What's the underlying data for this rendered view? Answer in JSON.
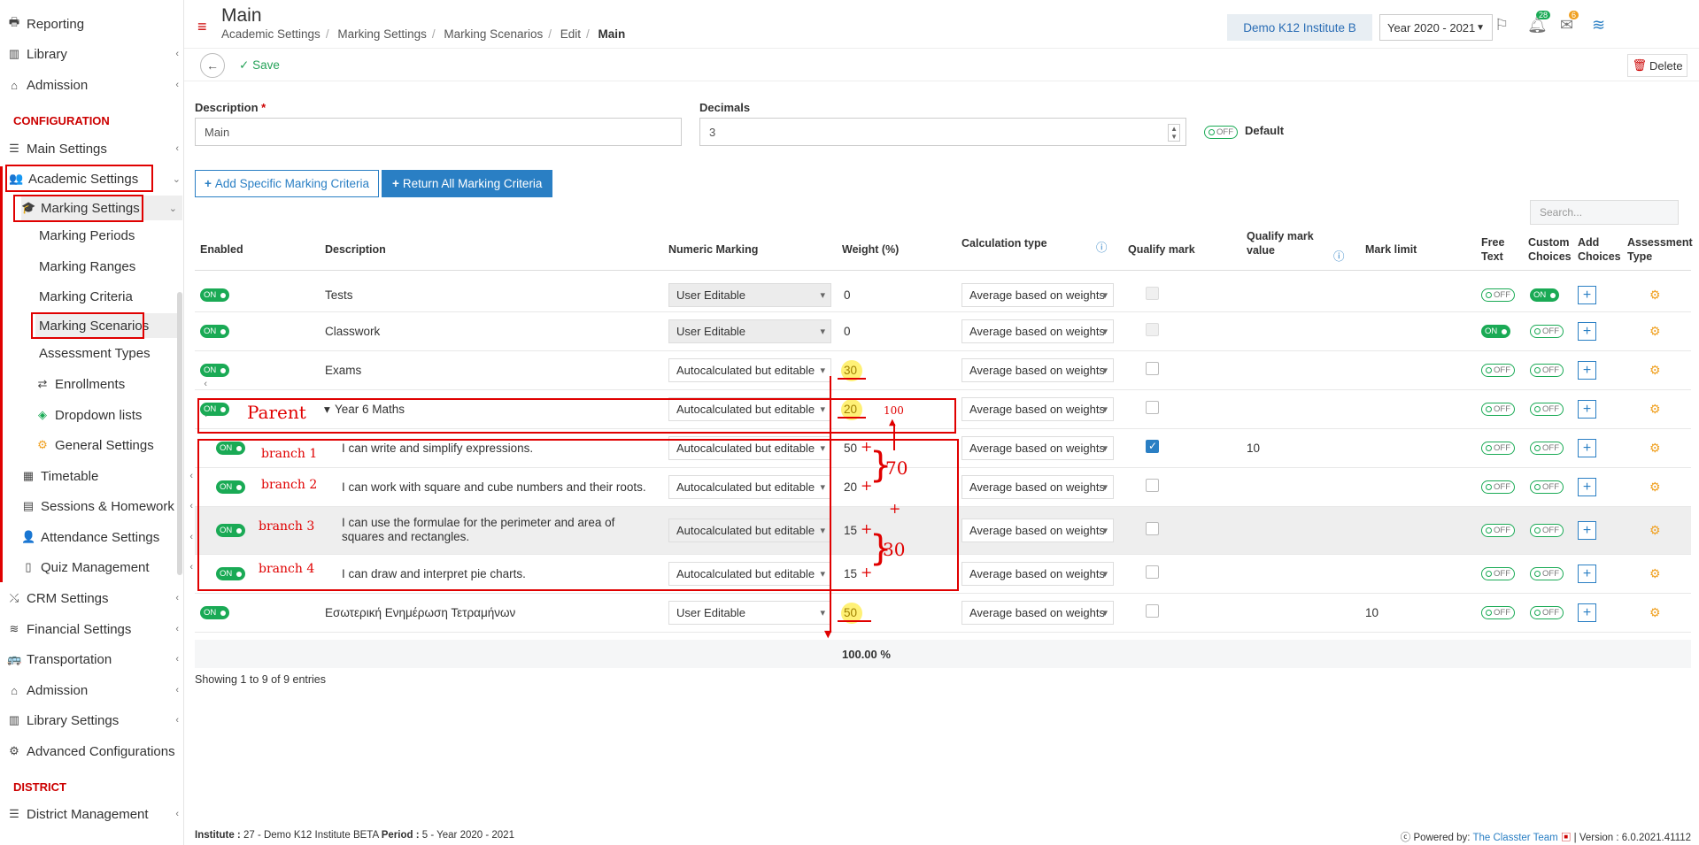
{
  "sidebar": {
    "top_items": [
      {
        "label": "Reporting",
        "icon": "printer-icon"
      },
      {
        "label": "Library",
        "icon": "books-icon"
      },
      {
        "label": "Admission",
        "icon": "institution-icon"
      }
    ],
    "config_heading": "CONFIGURATION",
    "main_settings": "Main Settings",
    "academic_settings": "Academic Settings",
    "marking_settings": "Marking Settings",
    "marking_children": [
      "Marking Periods",
      "Marking Ranges",
      "Marking Criteria",
      "Marking Scenarios",
      "Assessment Types"
    ],
    "enrollments": "Enrollments",
    "dropdown_lists": "Dropdown lists",
    "general_settings": "General Settings",
    "timetable": "Timetable",
    "sessions_homework": "Sessions & Homework",
    "attendance_settings": "Attendance Settings",
    "quiz_management": "Quiz Management",
    "crm_settings": "CRM Settings",
    "financial_settings": "Financial Settings",
    "transportation": "Transportation",
    "admission2": "Admission",
    "library_settings": "Library Settings",
    "advanced_configurations": "Advanced Configurations",
    "district_heading": "DISTRICT",
    "district_management": "District Management"
  },
  "header": {
    "title": "Main",
    "breadcrumb": [
      "Academic Settings",
      "Marking Settings",
      "Marking Scenarios",
      "Edit",
      "Main"
    ],
    "institute": "Demo K12 Institute B",
    "year": "Year 2020 - 2021",
    "notif_count": "28",
    "mail_count": "6",
    "user": "1 1"
  },
  "toolbar": {
    "save": "Save",
    "delete": "Delete"
  },
  "form": {
    "description_label": "Description",
    "description_value": "Main",
    "decimals_label": "Decimals",
    "decimals_value": "3",
    "default_toggle": "OFF",
    "default_label": "Default"
  },
  "actions": {
    "add_specific": "Add Specific Marking Criteria",
    "return_all": "Return All Marking Criteria",
    "search_placeholder": "Search..."
  },
  "table": {
    "headers": {
      "enabled": "Enabled",
      "description": "Description",
      "numeric": "Numeric Marking",
      "weight": "Weight (%)",
      "calc": "Calculation type",
      "qualify": "Qualify mark",
      "qualify_value": "Qualify mark value",
      "mark_limit": "Mark limit",
      "free_text": "Free Text",
      "custom_choices": "Custom Choices",
      "add_choices": "Add Choices",
      "assessment_type": "Assessment Type"
    },
    "rows": [
      {
        "enabled": "ON",
        "description": "Tests",
        "numeric": "User Editable",
        "weight": "0",
        "calc": "Average based on weights",
        "qualify_value": "",
        "mark_limit": "",
        "free": "OFF",
        "custom": "ON"
      },
      {
        "enabled": "ON",
        "description": "Classwork",
        "numeric": "User Editable",
        "weight": "0",
        "calc": "Average based on weights",
        "qualify_value": "",
        "mark_limit": "",
        "free": "ON",
        "custom": "OFF"
      },
      {
        "enabled": "ON",
        "description": "Exams",
        "numeric": "Autocalculated but editable",
        "weight": "30",
        "calc": "Average based on weights",
        "qualify_value": "",
        "mark_limit": "",
        "free": "OFF",
        "custom": "OFF"
      },
      {
        "enabled": "ON",
        "description": "Year 6 Maths",
        "numeric": "Autocalculated but editable",
        "weight": "20",
        "calc": "Average based on weights",
        "qualify_value": "",
        "mark_limit": "",
        "free": "OFF",
        "custom": "OFF"
      },
      {
        "enabled": "ON",
        "description": "I can write and simplify expressions.",
        "numeric": "Autocalculated but editable",
        "weight": "50",
        "calc": "Average based on weights",
        "qualify_value": "10",
        "mark_limit": "",
        "free": "OFF",
        "custom": "OFF"
      },
      {
        "enabled": "ON",
        "description": "I can work with square and cube numbers and their roots.",
        "numeric": "Autocalculated but editable",
        "weight": "20",
        "calc": "Average based on weights",
        "qualify_value": "",
        "mark_limit": "",
        "free": "OFF",
        "custom": "OFF"
      },
      {
        "enabled": "ON",
        "description": "I can use the formulae for the perimeter and area of squares and rectangles.",
        "numeric": "Autocalculated but editable",
        "weight": "15",
        "calc": "Average based on weights",
        "qualify_value": "",
        "mark_limit": "",
        "free": "OFF",
        "custom": "OFF"
      },
      {
        "enabled": "ON",
        "description": "I can draw and interpret pie charts.",
        "numeric": "Autocalculated but editable",
        "weight": "15",
        "calc": "Average based on weights",
        "qualify_value": "",
        "mark_limit": "",
        "free": "OFF",
        "custom": "OFF"
      },
      {
        "enabled": "ON",
        "description": "Εσωτερική Ενημέρωση Τετραμήνων",
        "numeric": "User Editable",
        "weight": "50",
        "calc": "Average based on weights",
        "qualify_value": "",
        "mark_limit": "10",
        "free": "OFF",
        "custom": "OFF"
      }
    ],
    "total": "100.00 %",
    "showing": "Showing 1 to 9 of 9 entries"
  },
  "annotations": {
    "parent": "Parent",
    "branches": [
      "branch 1",
      "branch 2",
      "branch 3",
      "branch 4"
    ],
    "hundred": "100",
    "seventy": "70",
    "plus": "+",
    "thirty": "30"
  },
  "footer": {
    "institute_label": "Institute :",
    "institute_value": "27 - Demo K12 Institute BETA",
    "period_label": "Period :",
    "period_value": "5 - Year 2020 - 2021",
    "powered_label": "Powered by:",
    "powered_value": "The Classter Team",
    "version": "| Version : 6.0.2021.41112"
  }
}
